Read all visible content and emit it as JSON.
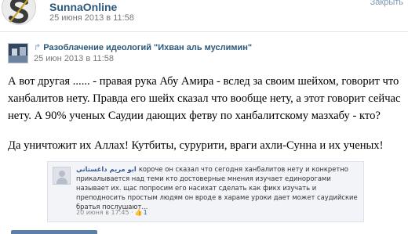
{
  "post": {
    "author": "SunnaOnline",
    "date": "25 июня 2013 в 11:58",
    "close_label": "Закрыть"
  },
  "repost": {
    "title": "Разоблачение идеологий \"Ихван аль муслимин\"",
    "date": "25 июн 2013 в 11:58",
    "icon": "repost-arrow-icon"
  },
  "text": {
    "paragraph_1": "А вот другая ...... - правая рука Абу Амира - вслед за своим шейхом, говорит что\nханбалитов нету. Правда его шейх сказал что вообще нету, а этот говорит сейчас\nнету. А 90% ученых Саудии дающих фетву по ханбалитскому мазхабу - кто?",
    "paragraph_2": "Да уничтожит их Аллах! Кутбиты, сурурити, враги ахли-Сунна и их ученых!"
  },
  "embedded_comment": {
    "author": "ابو مريم داغستاني",
    "text": "короче он сказал что сегодня ханбалитов нету и конкретно прикалывается над теми кто достоверные мнения изучает единорогами называет их. щас попросим его насихат сделать как фикх изучать и преподносить простым людям он вроде в хараме уроки дает может саудийские братья послушают...",
    "timestamp": "20 июня в 17:45",
    "separator": "·",
    "likes": "1"
  }
}
